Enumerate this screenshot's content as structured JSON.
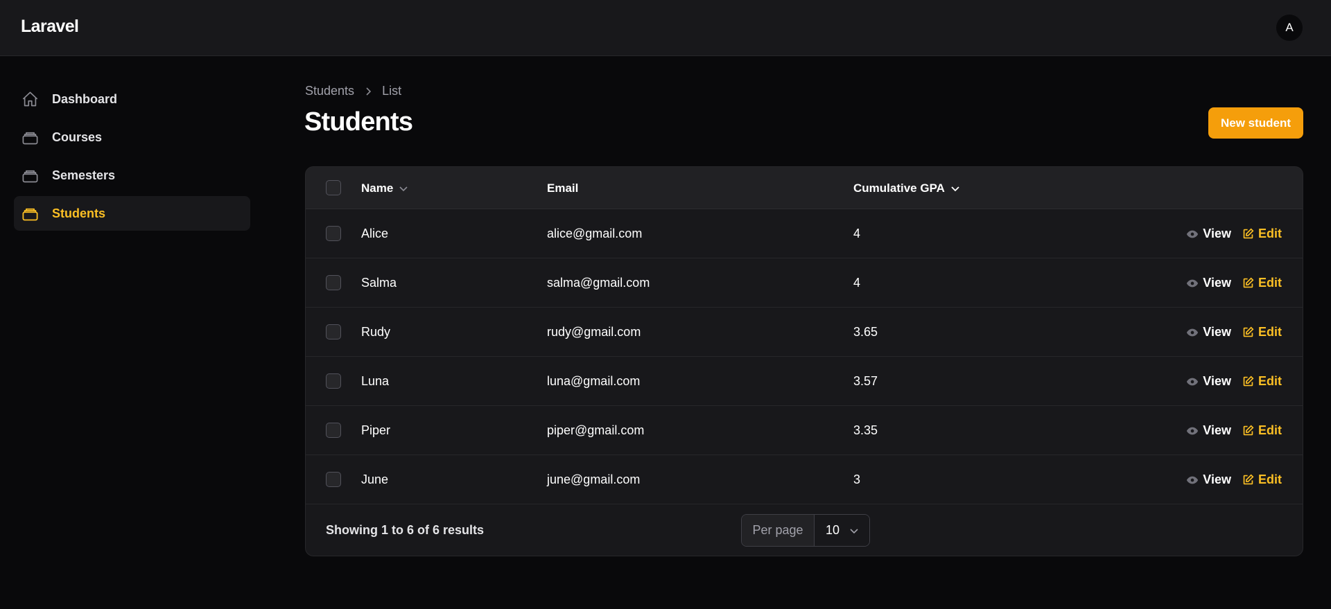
{
  "app": {
    "title": "Laravel",
    "avatar_initial": "A"
  },
  "sidebar": {
    "items": [
      {
        "label": "Dashboard",
        "icon": "home-icon",
        "active": false
      },
      {
        "label": "Courses",
        "icon": "stack-icon",
        "active": false
      },
      {
        "label": "Semesters",
        "icon": "stack-icon",
        "active": false
      },
      {
        "label": "Students",
        "icon": "stack-icon",
        "active": true
      }
    ]
  },
  "breadcrumb": {
    "items": [
      "Students",
      "List"
    ]
  },
  "page": {
    "title": "Students",
    "new_button": "New student"
  },
  "table": {
    "columns": {
      "name": "Name",
      "email": "Email",
      "gpa": "Cumulative GPA"
    },
    "rows": [
      {
        "name": "Alice",
        "email": "alice@gmail.com",
        "gpa": "4"
      },
      {
        "name": "Salma",
        "email": "salma@gmail.com",
        "gpa": "4"
      },
      {
        "name": "Rudy",
        "email": "rudy@gmail.com",
        "gpa": "3.65"
      },
      {
        "name": "Luna",
        "email": "luna@gmail.com",
        "gpa": "3.57"
      },
      {
        "name": "Piper",
        "email": "piper@gmail.com",
        "gpa": "3.35"
      },
      {
        "name": "June",
        "email": "june@gmail.com",
        "gpa": "3"
      }
    ],
    "actions": {
      "view": "View",
      "edit": "Edit"
    }
  },
  "footer": {
    "showing": "Showing 1 to 6 of 6 results",
    "per_page_label": "Per page",
    "per_page_value": "10"
  },
  "colors": {
    "accent": "#f59e0b",
    "accent_text": "#fbbf24",
    "background": "#09090b",
    "surface": "#18181b"
  }
}
